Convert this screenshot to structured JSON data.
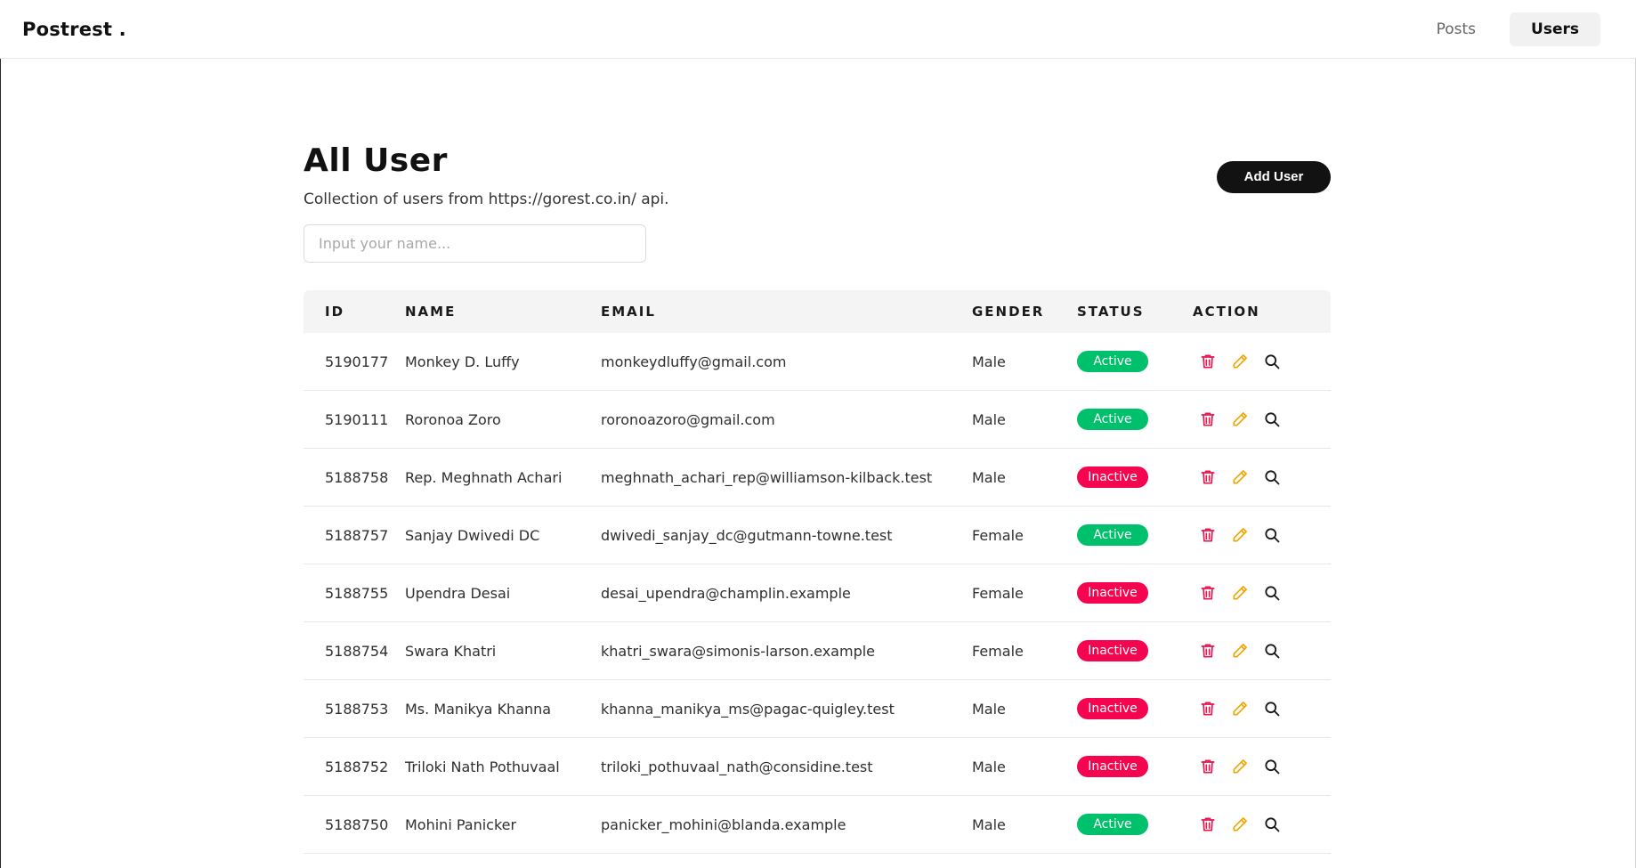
{
  "header": {
    "brand": "Postrest .",
    "nav": [
      {
        "label": "Posts",
        "active": false
      },
      {
        "label": "Users",
        "active": true
      }
    ]
  },
  "page": {
    "title": "All User",
    "subtitle": "Collection of users from https://gorest.co.in/ api.",
    "add_button": "Add User",
    "search_placeholder": "Input your name..."
  },
  "table": {
    "columns": [
      "ID",
      "NAME",
      "EMAIL",
      "GENDER",
      "STATUS",
      "ACTION"
    ],
    "rows": [
      {
        "id": "5190177",
        "name": "Monkey D. Luffy",
        "email": "monkeydluffy@gmail.com",
        "gender": "Male",
        "status": "Active"
      },
      {
        "id": "5190111",
        "name": "Roronoa Zoro",
        "email": "roronoazoro@gmail.com",
        "gender": "Male",
        "status": "Active"
      },
      {
        "id": "5188758",
        "name": "Rep. Meghnath Achari",
        "email": "meghnath_achari_rep@williamson-kilback.test",
        "gender": "Male",
        "status": "Inactive"
      },
      {
        "id": "5188757",
        "name": "Sanjay Dwivedi DC",
        "email": "dwivedi_sanjay_dc@gutmann-towne.test",
        "gender": "Female",
        "status": "Active"
      },
      {
        "id": "5188755",
        "name": "Upendra Desai",
        "email": "desai_upendra@champlin.example",
        "gender": "Female",
        "status": "Inactive"
      },
      {
        "id": "5188754",
        "name": "Swara Khatri",
        "email": "khatri_swara@simonis-larson.example",
        "gender": "Female",
        "status": "Inactive"
      },
      {
        "id": "5188753",
        "name": "Ms. Manikya Khanna",
        "email": "khanna_manikya_ms@pagac-quigley.test",
        "gender": "Male",
        "status": "Inactive"
      },
      {
        "id": "5188752",
        "name": "Triloki Nath Pothuvaal",
        "email": "triloki_pothuvaal_nath@considine.test",
        "gender": "Male",
        "status": "Inactive"
      },
      {
        "id": "5188750",
        "name": "Mohini Panicker",
        "email": "panicker_mohini@blanda.example",
        "gender": "Male",
        "status": "Active"
      }
    ]
  },
  "colors": {
    "active": "#00c16b",
    "inactive": "#f5054f",
    "delete_icon": "#e8174f",
    "edit_icon": "#f0a500",
    "view_icon": "#1a1a1a"
  },
  "icons": {
    "delete": "trash-icon",
    "edit": "pencil-icon",
    "view": "search-icon"
  }
}
